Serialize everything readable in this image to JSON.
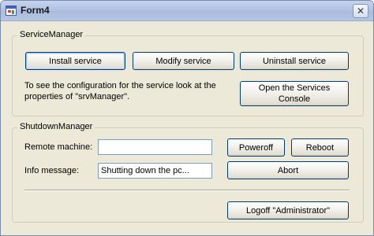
{
  "window": {
    "title": "Form4",
    "close_glyph": "✕"
  },
  "service_manager": {
    "legend": "ServiceManager",
    "install_label": "Install service",
    "modify_label": "Modify service",
    "uninstall_label": "Uninstall service",
    "info_text": "To see the configuration for the service look  at the properties of \"srvManager\".",
    "open_services_label": "Open the Services Console"
  },
  "shutdown_manager": {
    "legend": "ShutdownManager",
    "remote_machine_label": "Remote machine:",
    "remote_machine_value": "",
    "info_message_label": "Info message:",
    "info_message_value": "Shutting down the pc...",
    "poweroff_label": "Poweroff",
    "reboot_label": "Reboot",
    "abort_label": "Abort",
    "logoff_label": "Logoff \"Administrator\""
  }
}
